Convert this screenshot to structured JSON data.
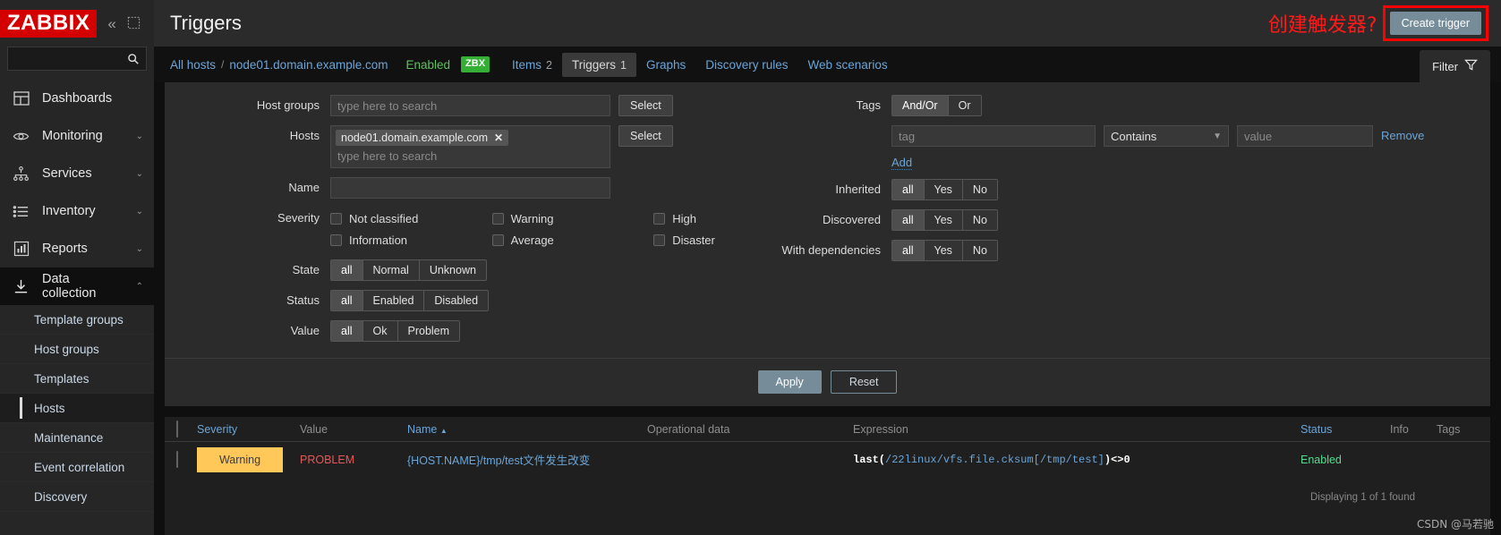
{
  "sidebar": {
    "logo": "ZABBIX",
    "collapse_icon": "chevron-double-left-icon",
    "expand_icon": "expand-icon",
    "search_placeholder": "",
    "search_value": "",
    "items": [
      {
        "label": "Dashboards",
        "icon": "dashboard-icon",
        "chevron": ""
      },
      {
        "label": "Monitoring",
        "icon": "eye-icon",
        "chevron": "⌄"
      },
      {
        "label": "Services",
        "icon": "sitemap-icon",
        "chevron": "⌄"
      },
      {
        "label": "Inventory",
        "icon": "list-icon",
        "chevron": "⌄"
      },
      {
        "label": "Reports",
        "icon": "bar-chart-icon",
        "chevron": "⌄"
      },
      {
        "label": "Data collection",
        "icon": "download-icon",
        "chevron": "⌃"
      }
    ],
    "subitems": [
      {
        "label": "Template groups",
        "active": false
      },
      {
        "label": "Host groups",
        "active": false
      },
      {
        "label": "Templates",
        "active": false
      },
      {
        "label": "Hosts",
        "active": true
      },
      {
        "label": "Maintenance",
        "active": false
      },
      {
        "label": "Event correlation",
        "active": false
      },
      {
        "label": "Discovery",
        "active": false
      }
    ]
  },
  "header": {
    "title": "Triggers",
    "annotation": "创建触发器?",
    "annotation_color": "#ff1a1a",
    "create_button": "Create trigger"
  },
  "breadcrumb": {
    "all_hosts": "All hosts",
    "separator": "/",
    "host": "node01.domain.example.com",
    "status": "Enabled",
    "status_color": "#5dc15d",
    "agent_badge": "ZBX",
    "agent_badge_color": "#34af34",
    "tabs": [
      {
        "label": "Items",
        "count": "2",
        "active": false
      },
      {
        "label": "Triggers",
        "count": "1",
        "active": true
      },
      {
        "label": "Graphs",
        "count": "",
        "active": false
      },
      {
        "label": "Discovery rules",
        "count": "",
        "active": false
      },
      {
        "label": "Web scenarios",
        "count": "",
        "active": false
      }
    ],
    "filter_tab": "Filter",
    "filter_icon": "funnel-icon"
  },
  "filter": {
    "host_groups": {
      "label": "Host groups",
      "placeholder": "type here to search",
      "value": "",
      "select_button": "Select"
    },
    "hosts": {
      "label": "Hosts",
      "placeholder": "type here to search",
      "chip": "node01.domain.example.com",
      "chip_remove": "✕",
      "select_button": "Select"
    },
    "name": {
      "label": "Name",
      "value": "",
      "placeholder": ""
    },
    "severity": {
      "label": "Severity",
      "options": [
        {
          "label": "Not classified",
          "checked": false
        },
        {
          "label": "Warning",
          "checked": false
        },
        {
          "label": "High",
          "checked": false
        },
        {
          "label": "Information",
          "checked": false
        },
        {
          "label": "Average",
          "checked": false
        },
        {
          "label": "Disaster",
          "checked": false
        }
      ]
    },
    "state": {
      "label": "State",
      "options": [
        "all",
        "Normal",
        "Unknown"
      ],
      "selected": "all"
    },
    "status": {
      "label": "Status",
      "options": [
        "all",
        "Enabled",
        "Disabled"
      ],
      "selected": "all"
    },
    "value": {
      "label": "Value",
      "options": [
        "all",
        "Ok",
        "Problem"
      ],
      "selected": "all"
    },
    "tags": {
      "label": "Tags",
      "operator_options": [
        "And/Or",
        "Or"
      ],
      "operator_selected": "And/Or",
      "tag_placeholder": "tag",
      "tag_value": "",
      "condition_selected": "Contains",
      "value_placeholder": "value",
      "value_value": "",
      "remove_label": "Remove",
      "add_label": "Add"
    },
    "inherited": {
      "label": "Inherited",
      "options": [
        "all",
        "Yes",
        "No"
      ],
      "selected": "all"
    },
    "discovered": {
      "label": "Discovered",
      "options": [
        "all",
        "Yes",
        "No"
      ],
      "selected": "all"
    },
    "with_dependencies": {
      "label": "With dependencies",
      "options": [
        "all",
        "Yes",
        "No"
      ],
      "selected": "all"
    },
    "apply_button": "Apply",
    "reset_button": "Reset"
  },
  "table": {
    "columns": {
      "severity": "Severity",
      "value": "Value",
      "name": "Name",
      "name_sort": "▲",
      "operational_data": "Operational data",
      "expression": "Expression",
      "status": "Status",
      "info": "Info",
      "tags": "Tags"
    },
    "rows": [
      {
        "severity": "Warning",
        "severity_color": "#ffc859",
        "value": "PROBLEM",
        "value_color": "#e45959",
        "name_prefix": "{HOST.NAME}",
        "name_suffix": "/tmp/test文件发生改变",
        "operational_data": "",
        "expr_func": "last(",
        "expr_link": "/22linux/vfs.file.cksum[/tmp/test]",
        "expr_tail": ")<>0",
        "status": "Enabled",
        "status_color": "#59db8f",
        "info": "",
        "tags": ""
      }
    ]
  },
  "footer": {
    "displaying": "Displaying 1 of 1 found",
    "watermark": "CSDN @马若驰"
  }
}
